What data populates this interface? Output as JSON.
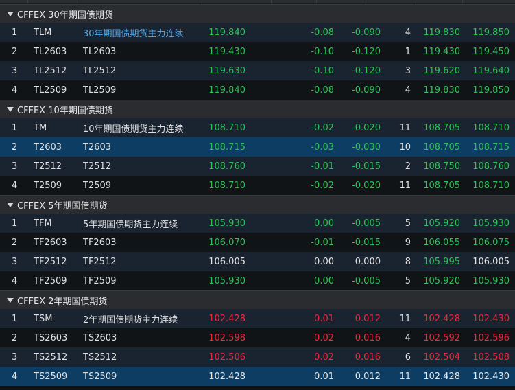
{
  "colors": {
    "up": "#f0293a",
    "down": "#2cc256",
    "flat": "#e6e6e6",
    "link": "#4fa8e8",
    "selected": "#0e3d63"
  },
  "groups": [
    {
      "title": "CFFEX 30年期国债期货",
      "rows": [
        {
          "idx": "1",
          "code": "TLM",
          "name": "30年期国债期货主力连续",
          "last": "119.840",
          "chg": "-0.08",
          "pct": "-0.090",
          "vol": "4",
          "bid": "119.830",
          "ask": "119.850",
          "c_last": "down",
          "c_chg": "down",
          "c_pct": "down",
          "c_bid": "down",
          "c_ask": "down",
          "name_link": true,
          "selected": false
        },
        {
          "idx": "2",
          "code": "TL2603",
          "name": "TL2603",
          "last": "119.430",
          "chg": "-0.10",
          "pct": "-0.120",
          "vol": "1",
          "bid": "119.430",
          "ask": "119.450",
          "c_last": "down",
          "c_chg": "down",
          "c_pct": "down",
          "c_bid": "down",
          "c_ask": "down",
          "selected": false
        },
        {
          "idx": "3",
          "code": "TL2512",
          "name": "TL2512",
          "last": "119.630",
          "chg": "-0.10",
          "pct": "-0.120",
          "vol": "3",
          "bid": "119.620",
          "ask": "119.640",
          "c_last": "down",
          "c_chg": "down",
          "c_pct": "down",
          "c_bid": "down",
          "c_ask": "down",
          "selected": false
        },
        {
          "idx": "4",
          "code": "TL2509",
          "name": "TL2509",
          "last": "119.840",
          "chg": "-0.08",
          "pct": "-0.090",
          "vol": "4",
          "bid": "119.830",
          "ask": "119.850",
          "c_last": "down",
          "c_chg": "down",
          "c_pct": "down",
          "c_bid": "down",
          "c_ask": "down",
          "selected": false
        }
      ]
    },
    {
      "title": "CFFEX 10年期国债期货",
      "rows": [
        {
          "idx": "1",
          "code": "TM",
          "name": "10年期国债期货主力连续",
          "last": "108.710",
          "chg": "-0.02",
          "pct": "-0.020",
          "vol": "11",
          "bid": "108.705",
          "ask": "108.710",
          "c_last": "down",
          "c_chg": "down",
          "c_pct": "down",
          "c_bid": "down",
          "c_ask": "down",
          "selected": false
        },
        {
          "idx": "2",
          "code": "T2603",
          "name": "T2603",
          "last": "108.715",
          "chg": "-0.03",
          "pct": "-0.030",
          "vol": "10",
          "bid": "108.705",
          "ask": "108.715",
          "c_last": "down",
          "c_chg": "down",
          "c_pct": "down",
          "c_bid": "down",
          "c_ask": "down",
          "selected": true
        },
        {
          "idx": "3",
          "code": "T2512",
          "name": "T2512",
          "last": "108.760",
          "chg": "-0.01",
          "pct": "-0.015",
          "vol": "2",
          "bid": "108.750",
          "ask": "108.760",
          "c_last": "down",
          "c_chg": "down",
          "c_pct": "down",
          "c_bid": "down",
          "c_ask": "down",
          "selected": false
        },
        {
          "idx": "4",
          "code": "T2509",
          "name": "T2509",
          "last": "108.710",
          "chg": "-0.02",
          "pct": "-0.020",
          "vol": "11",
          "bid": "108.705",
          "ask": "108.710",
          "c_last": "down",
          "c_chg": "down",
          "c_pct": "down",
          "c_bid": "down",
          "c_ask": "down",
          "selected": false
        }
      ]
    },
    {
      "title": "CFFEX 5年期国债期货",
      "rows": [
        {
          "idx": "1",
          "code": "TFM",
          "name": "5年期国债期货主力连续",
          "last": "105.930",
          "chg": "0.00",
          "pct": "-0.005",
          "vol": "5",
          "bid": "105.920",
          "ask": "105.930",
          "c_last": "down",
          "c_chg": "down",
          "c_pct": "down",
          "c_bid": "down",
          "c_ask": "down",
          "selected": false
        },
        {
          "idx": "2",
          "code": "TF2603",
          "name": "TF2603",
          "last": "106.070",
          "chg": "-0.01",
          "pct": "-0.015",
          "vol": "9",
          "bid": "106.055",
          "ask": "106.075",
          "c_last": "down",
          "c_chg": "down",
          "c_pct": "down",
          "c_bid": "down",
          "c_ask": "down",
          "selected": false
        },
        {
          "idx": "3",
          "code": "TF2512",
          "name": "TF2512",
          "last": "106.005",
          "chg": "0.00",
          "pct": "0.000",
          "vol": "8",
          "bid": "105.995",
          "ask": "106.005",
          "c_last": "flat",
          "c_chg": "flat",
          "c_pct": "flat",
          "c_bid": "down",
          "c_ask": "flat",
          "selected": false
        },
        {
          "idx": "4",
          "code": "TF2509",
          "name": "TF2509",
          "last": "105.930",
          "chg": "0.00",
          "pct": "-0.005",
          "vol": "5",
          "bid": "105.920",
          "ask": "105.930",
          "c_last": "down",
          "c_chg": "down",
          "c_pct": "down",
          "c_bid": "down",
          "c_ask": "down",
          "selected": false
        }
      ]
    },
    {
      "title": "CFFEX 2年期国债期货",
      "rows": [
        {
          "idx": "1",
          "code": "TSM",
          "name": "2年期国债期货主力连续",
          "last": "102.428",
          "chg": "0.01",
          "pct": "0.012",
          "vol": "11",
          "bid": "102.428",
          "ask": "102.430",
          "c_last": "up",
          "c_chg": "up",
          "c_pct": "up",
          "c_bid": "up",
          "c_ask": "up",
          "selected": false
        },
        {
          "idx": "2",
          "code": "TS2603",
          "name": "TS2603",
          "last": "102.598",
          "chg": "0.02",
          "pct": "0.016",
          "vol": "4",
          "bid": "102.592",
          "ask": "102.596",
          "c_last": "up",
          "c_chg": "up",
          "c_pct": "up",
          "c_bid": "up",
          "c_ask": "up",
          "selected": false
        },
        {
          "idx": "3",
          "code": "TS2512",
          "name": "TS2512",
          "last": "102.506",
          "chg": "0.02",
          "pct": "0.016",
          "vol": "6",
          "bid": "102.504",
          "ask": "102.508",
          "c_last": "up",
          "c_chg": "up",
          "c_pct": "up",
          "c_bid": "up",
          "c_ask": "up",
          "selected": false
        },
        {
          "idx": "4",
          "code": "TS2509",
          "name": "TS2509",
          "last": "102.428",
          "chg": "0.01",
          "pct": "0.012",
          "vol": "11",
          "bid": "102.428",
          "ask": "102.430",
          "c_last": "flat",
          "c_chg": "flat",
          "c_pct": "flat",
          "c_bid": "flat",
          "c_ask": "flat",
          "selected": true
        }
      ]
    }
  ]
}
